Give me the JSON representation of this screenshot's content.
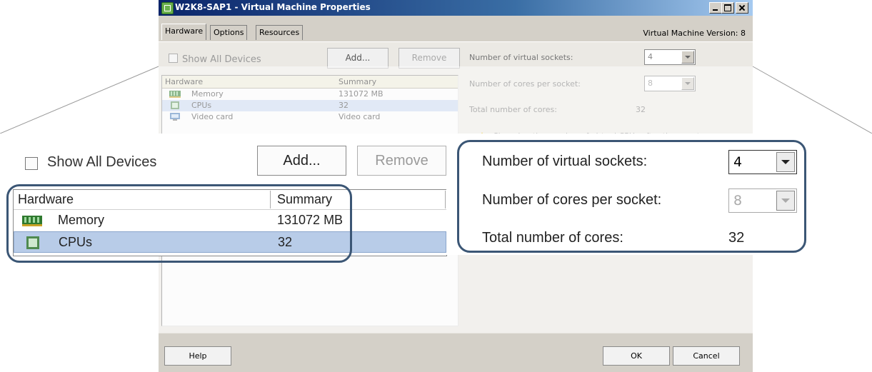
{
  "window": {
    "title": "W2K8-SAP1 - Virtual Machine Properties",
    "version": "Virtual Machine Version: 8",
    "tabs": [
      "Hardware",
      "Options",
      "Resources"
    ]
  },
  "background": {
    "show_all_devices": "Show All Devices",
    "add_label": "Add...",
    "remove_label": "Remove",
    "table": {
      "headers": [
        "Hardware",
        "Summary"
      ],
      "rows": [
        {
          "name": "Memory",
          "summary": "131072 MB"
        },
        {
          "name": "CPUs",
          "summary": "32"
        },
        {
          "name": "Video card",
          "summary": "Video card"
        }
      ]
    },
    "sockets_label": "Number of virtual sockets:",
    "sockets_value": "4",
    "cores_label": "Number of cores per socket:",
    "cores_value": "8",
    "total_label": "Total number of cores:",
    "total_value": "32",
    "warning": "Changing the number of virtual CPUs after the guest"
  },
  "zoom": {
    "show_all_devices": "Show All Devices",
    "add_label": "Add...",
    "remove_label": "Remove",
    "table": {
      "headers": [
        "Hardware",
        "Summary"
      ],
      "rows": [
        {
          "name": "Memory",
          "summary": "131072 MB"
        },
        {
          "name": "CPUs",
          "summary": "32"
        }
      ]
    },
    "sockets_label": "Number of virtual sockets:",
    "sockets_value": "4",
    "cores_label": "Number of cores per socket:",
    "cores_value": "8",
    "total_label": "Total number of cores:",
    "total_value": "32"
  },
  "footer": {
    "help": "Help",
    "ok": "OK",
    "cancel": "Cancel"
  },
  "colors": {
    "highlight_ring": "#3b5675",
    "selected_row": "#b8cce8",
    "titlebar": "#0a246a"
  },
  "icons": {
    "title": "vm-icon",
    "memory": "memory-icon",
    "cpu": "cpu-icon",
    "video": "monitor-icon",
    "warning": "warning-icon"
  }
}
